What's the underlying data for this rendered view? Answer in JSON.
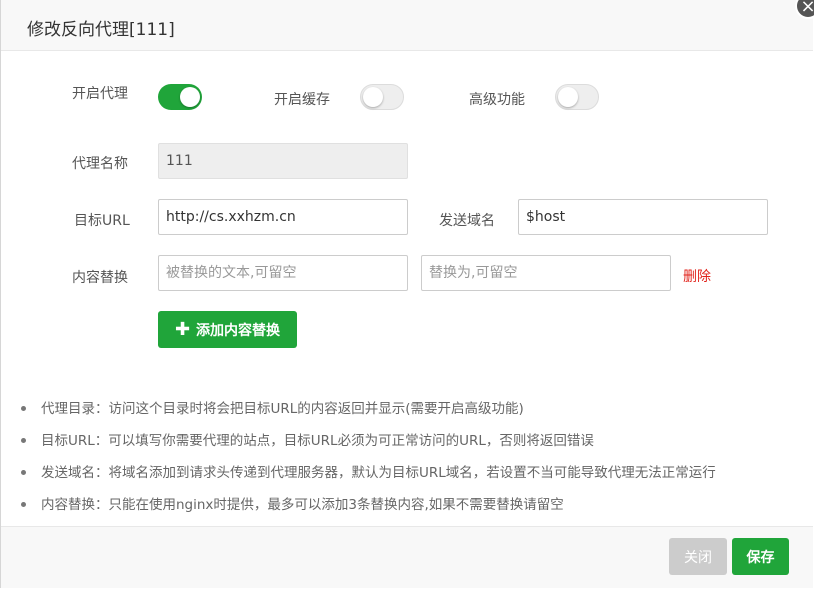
{
  "dialog": {
    "title": "修改反向代理[111]",
    "close_glyph": "×"
  },
  "switches": {
    "proxy": {
      "label": "开启代理",
      "on": true
    },
    "cache": {
      "label": "开启缓存",
      "on": false
    },
    "advanced": {
      "label": "高级功能",
      "on": false
    }
  },
  "form": {
    "name": {
      "label": "代理名称",
      "value": "111"
    },
    "target": {
      "label": "目标URL",
      "value": "http://cs.xxhzm.cn"
    },
    "host": {
      "label": "发送域名",
      "value": "$host"
    },
    "replace": {
      "label": "内容替换",
      "from_placeholder": "被替换的文本,可留空",
      "to_placeholder": "替换为,可留空",
      "delete_label": "删除"
    },
    "add_replace_label": "添加内容替换",
    "add_icon": "plus-icon"
  },
  "notes": [
    "代理目录：访问这个目录时将会把目标URL的内容返回并显示(需要开启高级功能)",
    "目标URL：可以填写你需要代理的站点，目标URL必须为可正常访问的URL，否则将返回错误",
    "发送域名：将域名添加到请求头传递到代理服务器，默认为目标URL域名，若设置不当可能导致代理无法正常运行",
    "内容替换：只能在使用nginx时提供，最多可以添加3条替换内容,如果不需要替换请留空"
  ],
  "footer": {
    "close_label": "关闭",
    "save_label": "保存"
  },
  "colors": {
    "accent": "#20a53a",
    "danger": "#e1231b",
    "disabled": "#cccccc"
  }
}
